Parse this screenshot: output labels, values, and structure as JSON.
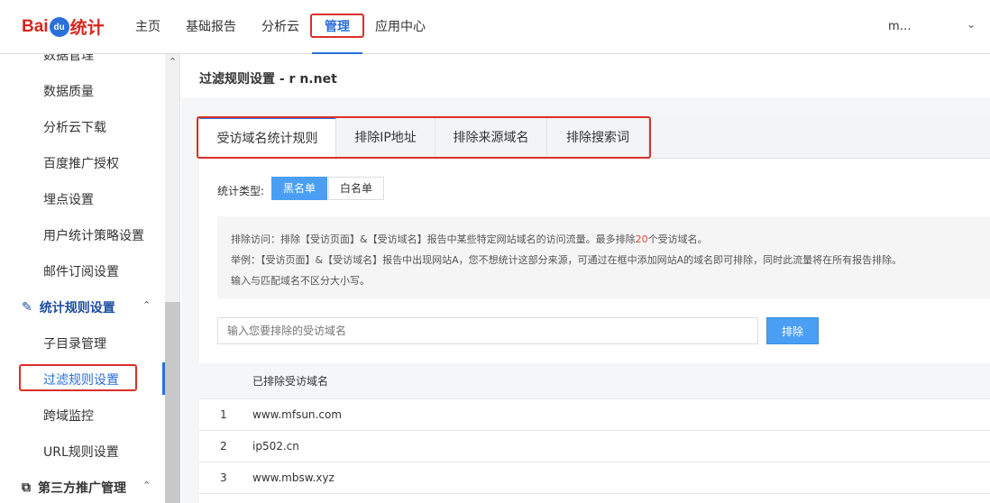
{
  "header": {
    "logo_text_left": "Bai",
    "logo_text_mid": "du",
    "logo_text_right": "统计",
    "nav": [
      "主页",
      "基础报告",
      "分析云",
      "管理",
      "应用中心"
    ],
    "active_nav": "管理",
    "user": "m…"
  },
  "sidebar": {
    "items_top": [
      "数据管理",
      "数据质量",
      "分析云下载",
      "百度推广授权",
      "埋点设置",
      "用户统计策略设置",
      "邮件订阅设置"
    ],
    "group1": "统计规则设置",
    "group1_items": [
      "子目录管理",
      "过滤规则设置",
      "跨域监控",
      "URL规则设置"
    ],
    "group2": "第三方推广管理"
  },
  "main": {
    "title": "过滤规则设置 - r        n.net",
    "tabs": [
      "受访域名统计规则",
      "排除IP地址",
      "排除来源域名",
      "排除搜索词"
    ],
    "type_label": "统计类型:",
    "type_options": [
      "黑名单",
      "白名单"
    ],
    "info": {
      "l1a": "排除访问：排除【受访页面】&【受访域名】报告中某些特定网站域名的访问流量。最多排除",
      "l1num": "20",
      "l1b": "个受访域名。",
      "l2": "举例：【受访页面】&【受访域名】报告中出现网站A，您不想统计这部分来源，可通过在框中添加网站A的域名即可排除，同时此流量将在所有报告排除。",
      "l3": "输入与匹配域名不区分大小写。"
    },
    "input_placeholder": "输入您要排除的受访域名",
    "button": "排除",
    "table_header": "已排除受访域名",
    "rows": [
      {
        "n": "1",
        "d": "www.mfsun.com"
      },
      {
        "n": "2",
        "d": "ip502.cn"
      },
      {
        "n": "3",
        "d": "www.mbsw.xyz"
      }
    ]
  },
  "colors": {
    "accent": "#2a6fdb",
    "button": "#4a9ff5",
    "highlight": "#d9302a"
  }
}
